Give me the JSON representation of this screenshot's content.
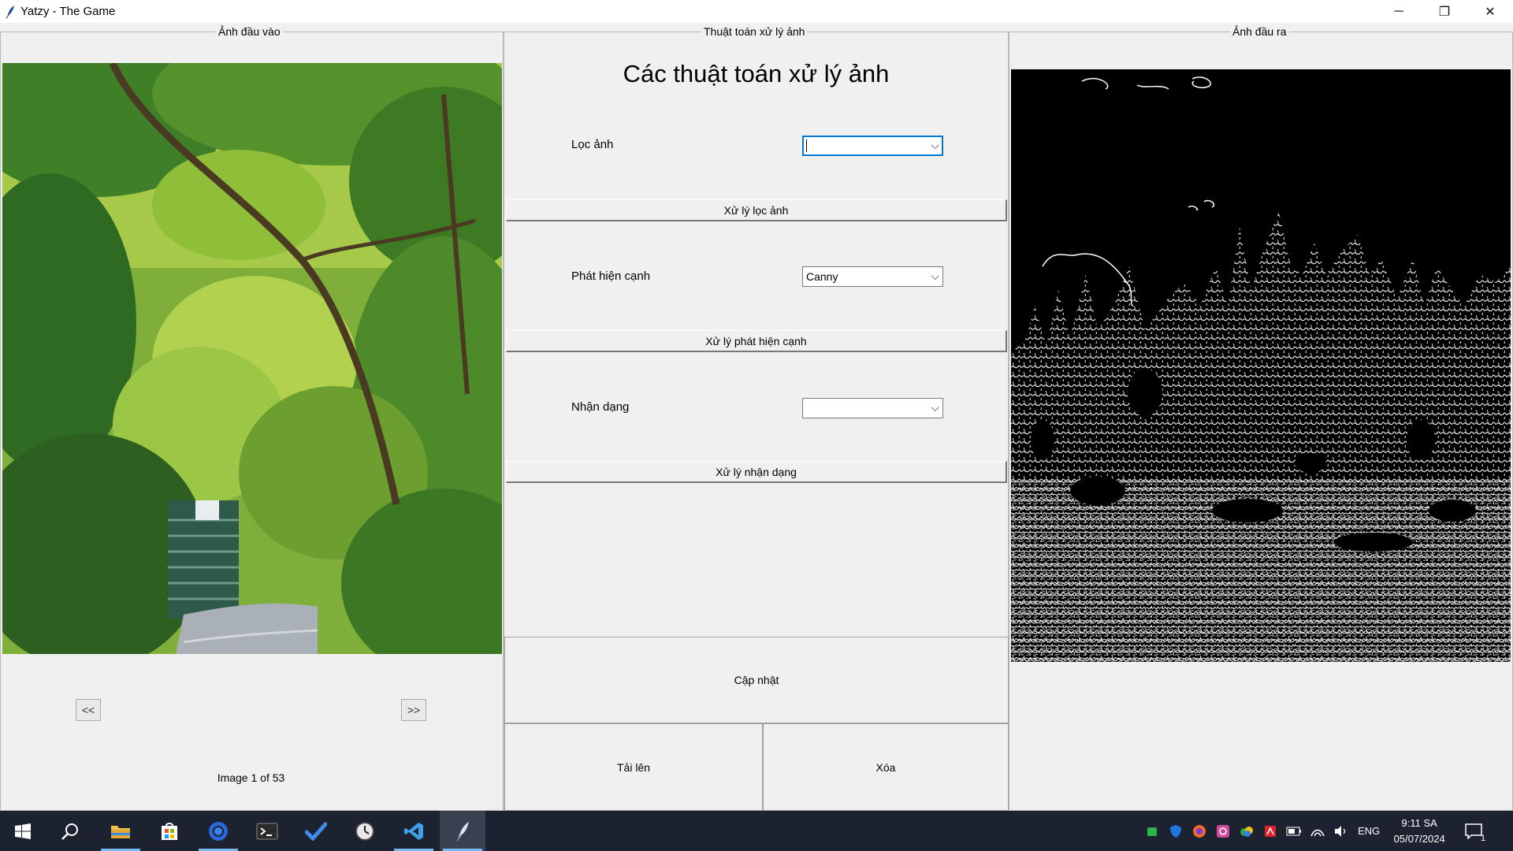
{
  "window": {
    "title": "Yatzy - The Game",
    "controls": {
      "minimize": "─",
      "restore": "❐",
      "close": "✕"
    }
  },
  "input_panel": {
    "label": "Ảnh đầu vào",
    "prev_label": "<<",
    "next_label": ">>",
    "counter": "Image 1 of 53"
  },
  "algo_panel": {
    "label": "Thuật toán xử lý ảnh",
    "heading": "Các thuật toán xử lý ảnh",
    "filter": {
      "label": "Lọc ảnh",
      "value": "",
      "button": "Xử lý lọc ảnh"
    },
    "edge": {
      "label": "Phát hiện cạnh",
      "value": "Canny",
      "button": "Xử lý phát hiện cạnh"
    },
    "recognize": {
      "label": "Nhận dạng",
      "value": "",
      "button": "Xử lý nhận dạng"
    },
    "update_button": "Cập nhật",
    "upload_button": "Tải lên",
    "delete_button": "Xóa"
  },
  "output_panel": {
    "label": "Ảnh đầu ra"
  },
  "taskbar": {
    "items": [
      "windows-start",
      "search",
      "file-explorer",
      "microsoft-store",
      "chrome",
      "terminal",
      "todo",
      "clock-app",
      "vscode",
      "python-tk"
    ],
    "language": "ENG",
    "time": "9:11 SA",
    "date": "05/07/2024",
    "notification_count": "1"
  },
  "colors": {
    "window_bg": "#f0f0f0",
    "taskbar_bg": "#1c2230",
    "focus_border": "#0078d7",
    "edge_bg": "#000000",
    "edge_line": "#ffffff"
  }
}
